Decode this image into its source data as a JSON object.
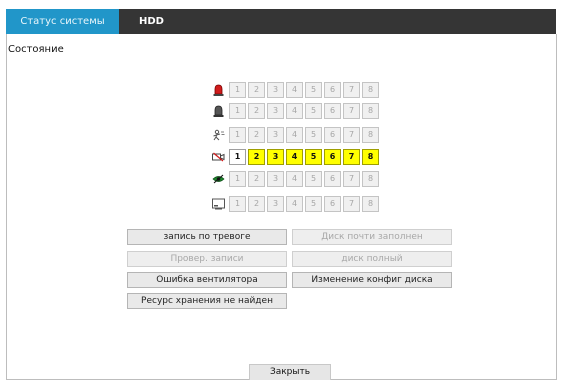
{
  "tabs": [
    {
      "label": "Статус системы",
      "active": true
    },
    {
      "label": "HDD",
      "active": false
    }
  ],
  "section_title": "Состояние",
  "channel_rows": [
    {
      "icon": "alarm-siren-red-icon",
      "cells": [
        "1",
        "2",
        "3",
        "4",
        "5",
        "6",
        "7",
        "8"
      ],
      "active": []
    },
    {
      "icon": "alarm-siren-gray-icon",
      "cells": [
        "1",
        "2",
        "3",
        "4",
        "5",
        "6",
        "7",
        "8"
      ],
      "active": []
    },
    {
      "icon": "motion-detection-icon",
      "cells": [
        "1",
        "2",
        "3",
        "4",
        "5",
        "6",
        "7",
        "8"
      ],
      "active": []
    },
    {
      "icon": "video-loss-icon",
      "cells": [
        "1",
        "2",
        "3",
        "4",
        "5",
        "6",
        "7",
        "8"
      ],
      "active": [
        "2",
        "3",
        "4",
        "5",
        "6",
        "7",
        "8"
      ],
      "white": [
        "1"
      ]
    },
    {
      "icon": "eye-blind-icon",
      "cells": [
        "1",
        "2",
        "3",
        "4",
        "5",
        "6",
        "7",
        "8"
      ],
      "active": []
    },
    {
      "icon": "record-monitor-icon",
      "cells": [
        "1",
        "2",
        "3",
        "4",
        "5",
        "6",
        "7",
        "8"
      ],
      "active": []
    }
  ],
  "status_buttons": [
    {
      "label": "запись по тревоге",
      "enabled": true
    },
    {
      "label": "Диск почти заполнен",
      "enabled": false
    },
    {
      "label": "Провер. записи",
      "enabled": false
    },
    {
      "label": "диск полный",
      "enabled": false
    },
    {
      "label": "Ошибка вентилятора",
      "enabled": true
    },
    {
      "label": "Изменение конфиг диска",
      "enabled": true
    },
    {
      "label": "Ресурс хранения не найден",
      "enabled": true
    }
  ],
  "close_label": "Закрыть",
  "colors": {
    "tab_active": "#2196c9",
    "tab_bar": "#353535",
    "cell_on": "#ffff00"
  }
}
